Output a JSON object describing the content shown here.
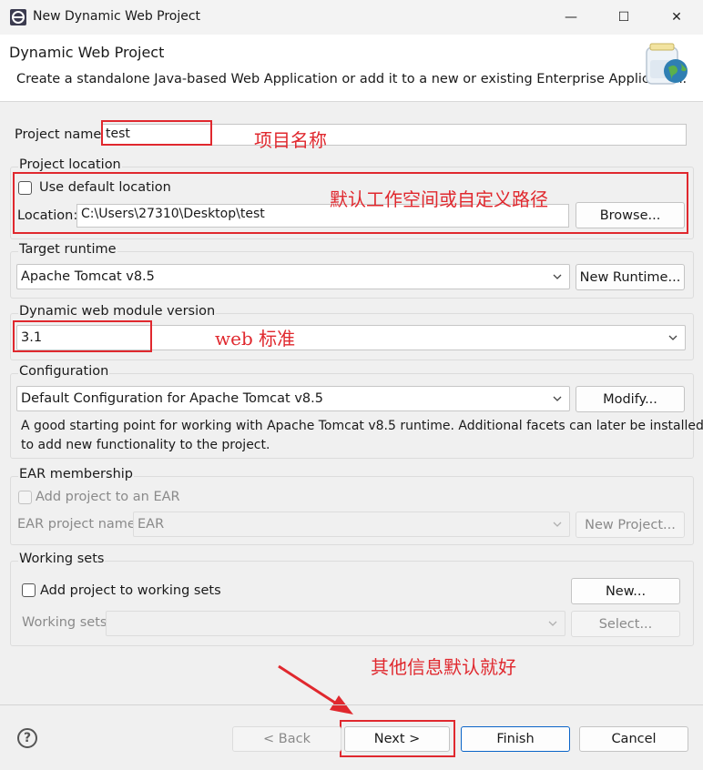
{
  "window": {
    "title": "New Dynamic Web Project",
    "minimize_glyph": "—",
    "maximize_glyph": "☐",
    "close_glyph": "✕"
  },
  "header": {
    "title": "Dynamic Web Project",
    "description": "Create a standalone Java-based Web Application or add it to a new or existing Enterprise Application."
  },
  "project_name": {
    "label": "Project name:",
    "value": "test"
  },
  "project_location": {
    "group_label": "Project location",
    "use_default_label": "Use default location",
    "use_default_checked": false,
    "location_label": "Location:",
    "location_value": "C:\\Users\\27310\\Desktop\\test",
    "browse_label": "Browse..."
  },
  "target_runtime": {
    "group_label": "Target runtime",
    "selected": "Apache Tomcat v8.5",
    "new_runtime_label": "New Runtime..."
  },
  "web_module": {
    "group_label": "Dynamic web module version",
    "selected": "3.1"
  },
  "configuration": {
    "group_label": "Configuration",
    "selected": "Default Configuration for Apache Tomcat v8.5",
    "modify_label": "Modify...",
    "description_line1": "A good starting point for working with Apache Tomcat v8.5 runtime. Additional facets can later be installed",
    "description_line2": "to add new functionality to the project."
  },
  "ear": {
    "group_label": "EAR membership",
    "add_label": "Add project to an EAR",
    "project_name_label": "EAR project name:",
    "project_name_value": "EAR",
    "new_project_label": "New Project..."
  },
  "working_sets": {
    "group_label": "Working sets",
    "add_label": "Add project to working sets",
    "new_label": "New...",
    "sets_label": "Working sets:",
    "select_label": "Select..."
  },
  "annotations": {
    "project_name": "项目名称",
    "location": "默认工作空间或自定义路径",
    "web_standard": "web 标准",
    "others_default": "其他信息默认就好"
  },
  "footer": {
    "help_glyph": "?",
    "back_label": "< Back",
    "next_label": "Next >",
    "finish_label": "Finish",
    "cancel_label": "Cancel"
  },
  "colors": {
    "annotation_red": "#e0282e",
    "dialog_bg": "#f0f0f0",
    "accent_blue": "#0a64c8"
  }
}
